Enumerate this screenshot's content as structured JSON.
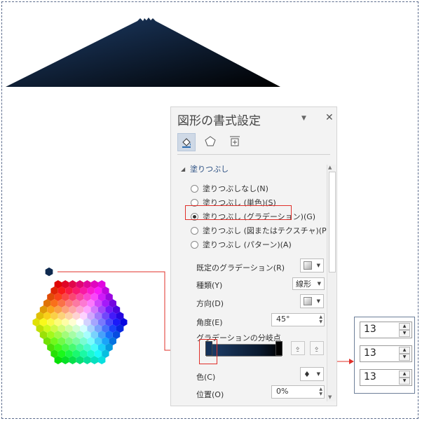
{
  "pane": {
    "title": "図形の書式設定",
    "tabs": [
      "fill-line-icon",
      "effects-icon",
      "size-properties-icon"
    ],
    "section_label": "塗りつぶし",
    "fill_options": [
      {
        "label": "塗りつぶしなし(N)",
        "selected": false
      },
      {
        "label": "塗りつぶし (単色)(S)",
        "selected": false
      },
      {
        "label": "塗りつぶし (グラデーション)(G)",
        "selected": true
      },
      {
        "label": "塗りつぶし (図またはテクスチャ)(P)",
        "selected": false
      },
      {
        "label": "塗りつぶし (パターン)(A)",
        "selected": false
      }
    ],
    "preset_label": "既定のグラデーション(R)",
    "type_label": "種類(Y)",
    "type_value": "線形",
    "direction_label": "方向(D)",
    "angle_label": "角度(E)",
    "angle_value": "45°",
    "stops_label": "グラデーションの分岐点",
    "color_label": "色(C)",
    "position_label": "位置(O)",
    "position_value": "0%"
  },
  "spinners": [
    "13",
    "13",
    "13"
  ],
  "colors": {
    "accent_red": "#e0302a",
    "gradient_start": "#1e3e6a",
    "gradient_end": "#000000",
    "title_blue": "#2b4f82"
  }
}
